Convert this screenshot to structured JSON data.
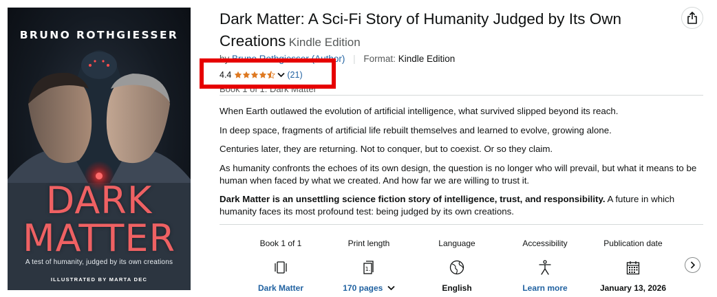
{
  "cover": {
    "author": "BRUNO ROTHGIESSER",
    "title_line1": "DARK",
    "title_line2": "MATTER",
    "tagline": "A test of humanity, judged by its own creations",
    "illustrator": "ILLUSTRATED BY MARTA DEC"
  },
  "header": {
    "title": "Dark Matter: A Sci-Fi Story of Humanity Judged by Its Own Creations",
    "edition": "Kindle Edition",
    "byline_prefix": "by",
    "author_link": "Bruno Rothgiesser (Author)",
    "format_label": "Format:",
    "format_value": "Kindle Edition",
    "series_text": "Book 1 of 1: Dark Matter",
    "share_icon": "share-icon"
  },
  "rating": {
    "value": "4.4",
    "stars": 4.4,
    "count": "(21)",
    "star_color": "#de7921",
    "highlight_color": "#e60000"
  },
  "description": {
    "p1": "When Earth outlawed the evolution of artificial intelligence, what survived slipped beyond its reach.",
    "p2": "In deep space, fragments of artificial life rebuilt themselves and learned to evolve, growing alone.",
    "p3": "Centuries later, they are returning. Not to conquer, but to coexist. Or so they claim.",
    "p4": "As humanity confronts the echoes of its own design, the question is no longer who will prevail, but what it means to be human when faced by what we created. And how far we are willing to trust it.",
    "p5_bold": "Dark Matter is an unsettling science fiction story of intelligence, trust, and responsibility.",
    "p5_rest": " A future in which humanity faces its most profound test: being judged by its own creations."
  },
  "details": [
    {
      "label": "Book 1 of 1",
      "icon": "book-series-icon",
      "value": "Dark Matter"
    },
    {
      "label": "Print length",
      "icon": "page-count-icon",
      "value": "170 pages"
    },
    {
      "label": "Language",
      "icon": "globe-icon",
      "value": "English"
    },
    {
      "label": "Accessibility",
      "icon": "accessibility-icon",
      "value": "Learn more"
    },
    {
      "label": "Publication date",
      "icon": "calendar-icon",
      "value": "January 13, 2026"
    }
  ],
  "colors": {
    "link": "#2162a1",
    "text": "#0f1111",
    "muted": "#565959",
    "cover_title": "#ef6163"
  }
}
